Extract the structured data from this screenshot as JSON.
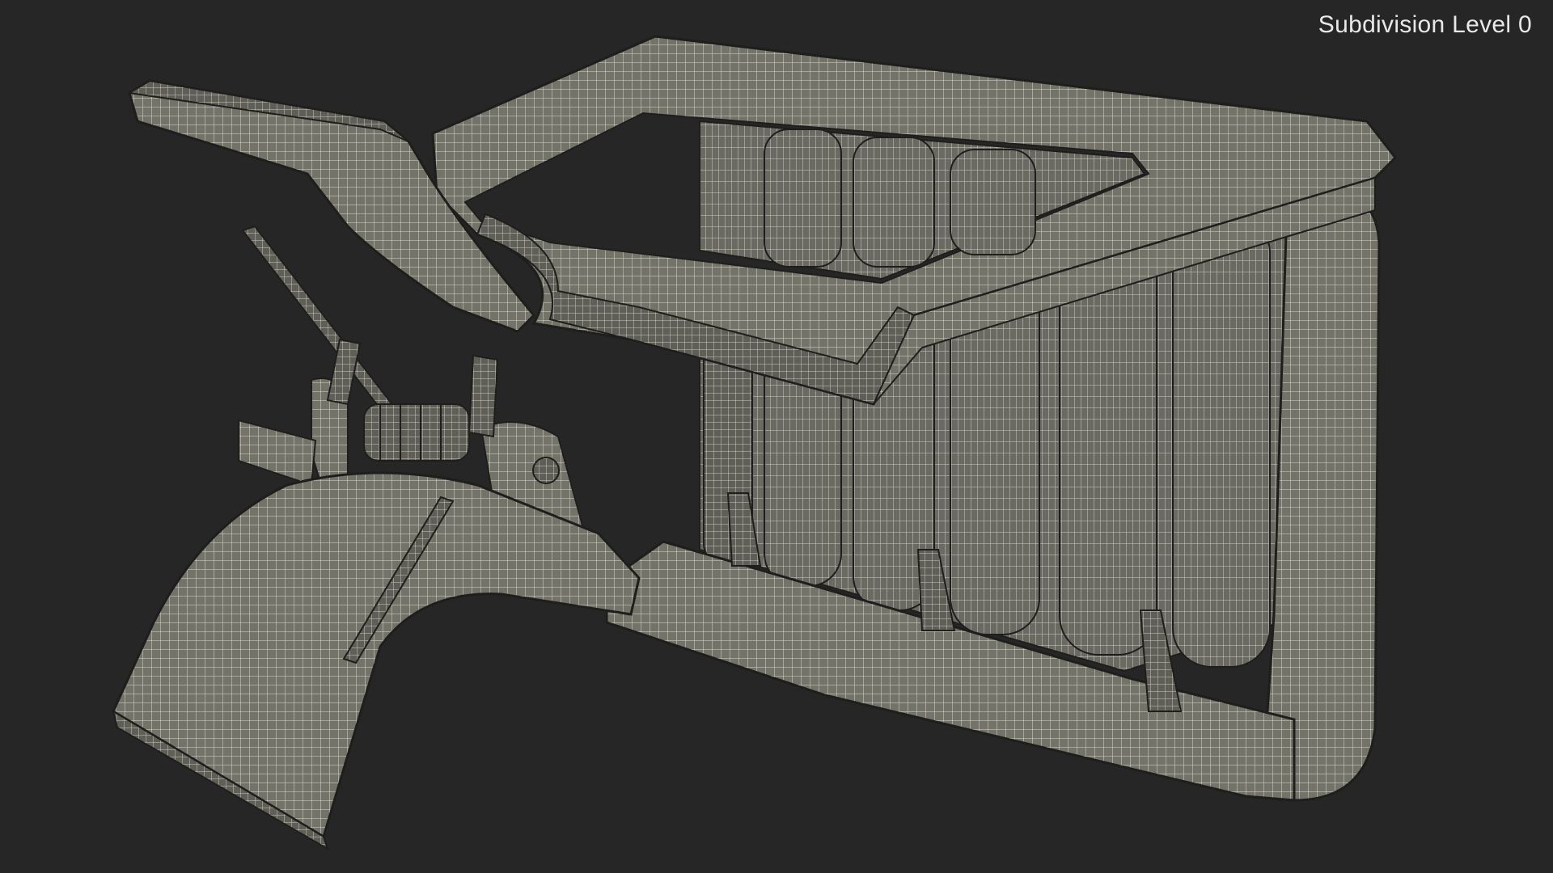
{
  "viewport": {
    "label": "Subdivision Level 0"
  },
  "colors": {
    "background": "#262626",
    "surface": "#73736a",
    "wire": "#d8d8cc",
    "edge": "#1e1e1c",
    "label": "#e8e8e8"
  }
}
